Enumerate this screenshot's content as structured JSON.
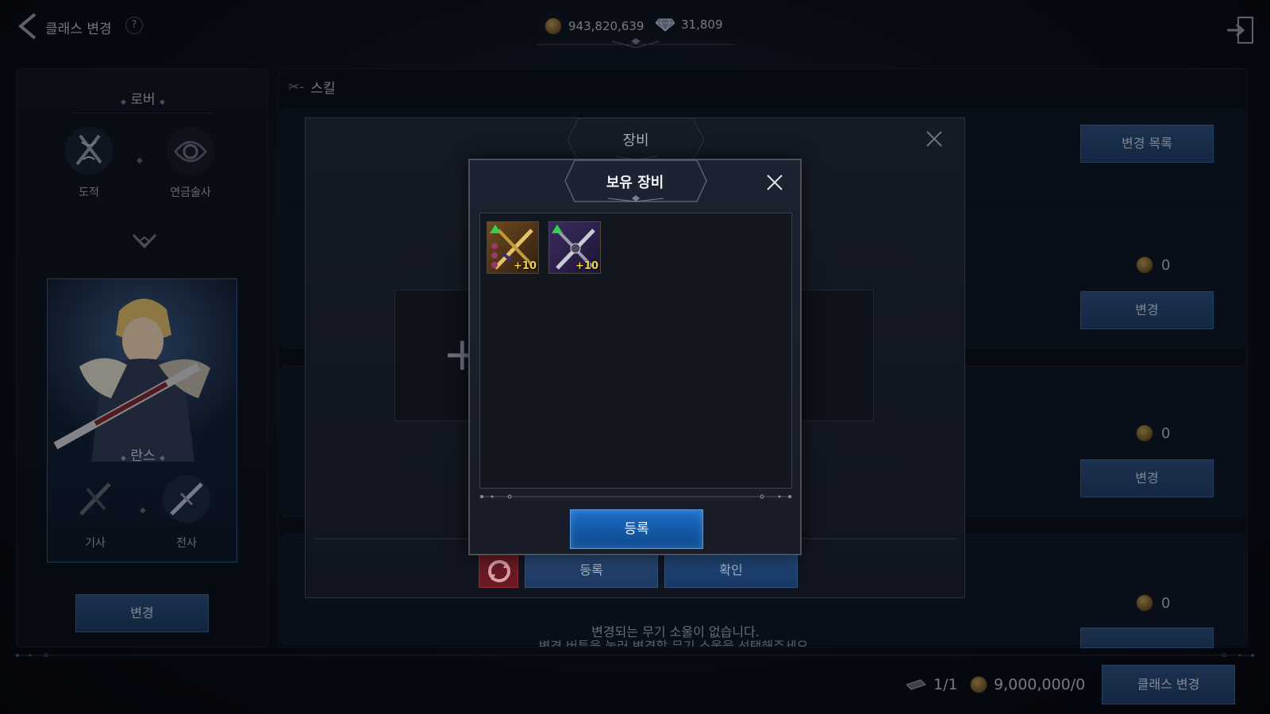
{
  "header": {
    "title": "클래스 변경",
    "help": "?",
    "gold": "943,820,639",
    "diamond": "31,809"
  },
  "left_panel": {
    "section": "로버",
    "class_a": "도적",
    "class_b": "연금술사",
    "selected_class": "란스",
    "class_c": "기사",
    "class_d": "전사",
    "change_button": "변경"
  },
  "main_panel": {
    "section": "스킬",
    "change_list_button": "변경 목록",
    "rows": [
      {
        "cost": "0",
        "button": "변경"
      },
      {
        "cost": "0",
        "button": "변경"
      },
      {
        "cost": "0",
        "button": ""
      }
    ],
    "message_line1": "변경되는 무기 소울이 없습니다.",
    "message_line2": "변경 버튼을 눌러 변경할 무기 소울을 선택해주세요."
  },
  "footer": {
    "tickets": "1/1",
    "gold_cost": "9,000,000/0",
    "class_change_button": "클래스 변경"
  },
  "equip_modal": {
    "title": "장비",
    "register_button": "등록",
    "confirm_button": "확인"
  },
  "owned_modal": {
    "title": "보유 장비",
    "items": [
      {
        "level": "+10",
        "grade": "gold"
      },
      {
        "level": "+10",
        "grade": "purple"
      }
    ],
    "register_button": "등록"
  },
  "colors": {
    "accent_blue": "#1f6fc9",
    "upgrade_green": "#2fd34a",
    "level_gold": "#f2d24a"
  }
}
